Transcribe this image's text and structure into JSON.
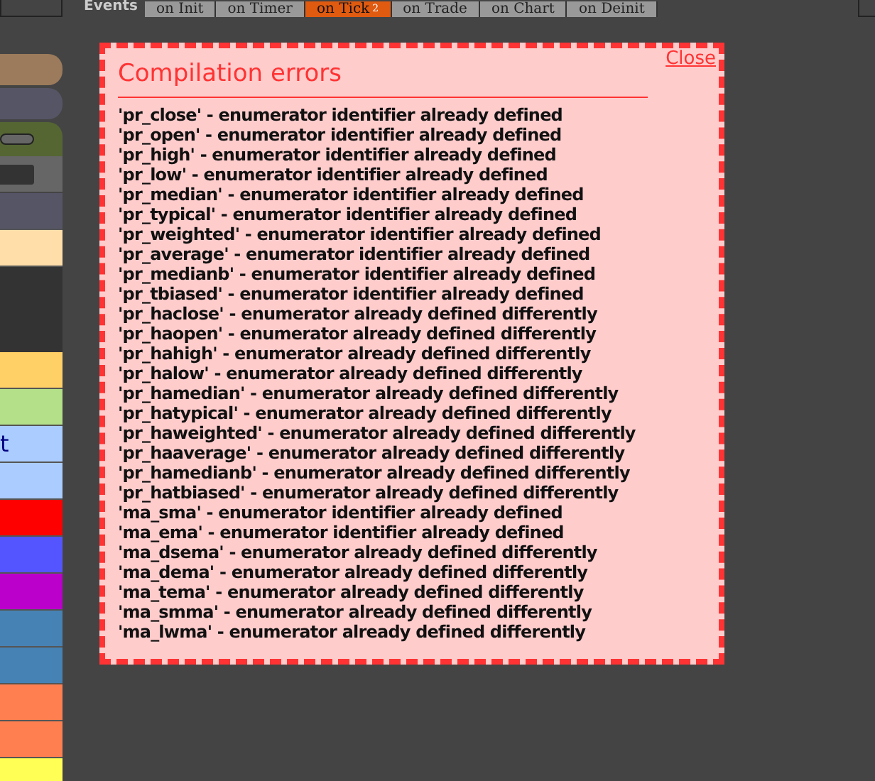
{
  "events_bar": {
    "label": "Events",
    "tabs": [
      {
        "label": "on Init",
        "selected": false
      },
      {
        "label": "on Timer",
        "selected": false
      },
      {
        "label": "on Tick",
        "badge": "2",
        "selected": true
      },
      {
        "label": "on Trade",
        "selected": false
      },
      {
        "label": "on Chart",
        "selected": false
      },
      {
        "label": "on Deinit",
        "selected": false
      }
    ]
  },
  "sidebar": {
    "items": [
      {
        "kind": "pill",
        "color": "#9b7b5b"
      },
      {
        "kind": "pill",
        "color": "#555566"
      },
      {
        "kind": "toggle",
        "color": "#556633"
      },
      {
        "kind": "field",
        "color": "#666666"
      },
      {
        "kind": "plain",
        "color": "#555566"
      },
      {
        "kind": "plain",
        "color": "#ffdeaa"
      },
      {
        "kind": "tall",
        "color": "#333333"
      },
      {
        "kind": "plain",
        "color": "#ffd066"
      },
      {
        "kind": "plain",
        "color": "#b3e088"
      },
      {
        "kind": "plain",
        "color": "#aaccff",
        "text": "t"
      },
      {
        "kind": "plain",
        "color": "#aaccff"
      },
      {
        "kind": "plain",
        "color": "#ff0000"
      },
      {
        "kind": "plain",
        "color": "#5555ff"
      },
      {
        "kind": "plain",
        "color": "#bb00cc"
      },
      {
        "kind": "plain",
        "color": "#4682b4"
      },
      {
        "kind": "plain",
        "color": "#4682b4"
      },
      {
        "kind": "plain",
        "color": "#ff7f50"
      },
      {
        "kind": "plain",
        "color": "#ff7f50"
      },
      {
        "kind": "plain",
        "color": "#ffff55"
      }
    ]
  },
  "dialog": {
    "title": "Compilation errors",
    "close": "Close",
    "errors": [
      "'pr_close' - enumerator identifier already defined",
      "'pr_open' - enumerator identifier already defined",
      "'pr_high' - enumerator identifier already defined",
      "'pr_low' - enumerator identifier already defined",
      "'pr_median' - enumerator identifier already defined",
      "'pr_typical' - enumerator identifier already defined",
      "'pr_weighted' - enumerator identifier already defined",
      "'pr_average' - enumerator identifier already defined",
      "'pr_medianb' - enumerator identifier already defined",
      "'pr_tbiased' - enumerator identifier already defined",
      "'pr_haclose' - enumerator already defined differently",
      "'pr_haopen' - enumerator already defined differently",
      "'pr_hahigh' - enumerator already defined differently",
      "'pr_halow' - enumerator already defined differently",
      "'pr_hamedian' - enumerator already defined differently",
      "'pr_hatypical' - enumerator already defined differently",
      "'pr_haweighted' - enumerator already defined differently",
      "'pr_haaverage' - enumerator already defined differently",
      "'pr_hamedianb' - enumerator already defined differently",
      "'pr_hatbiased' - enumerator already defined differently",
      "'ma_sma' - enumerator identifier already defined",
      "'ma_ema' - enumerator identifier already defined",
      "'ma_dsema' - enumerator already defined differently",
      "'ma_dema' - enumerator already defined differently",
      "'ma_tema' - enumerator already defined differently",
      "'ma_smma' - enumerator already defined differently",
      "'ma_lwma' - enumerator already defined differently"
    ]
  }
}
